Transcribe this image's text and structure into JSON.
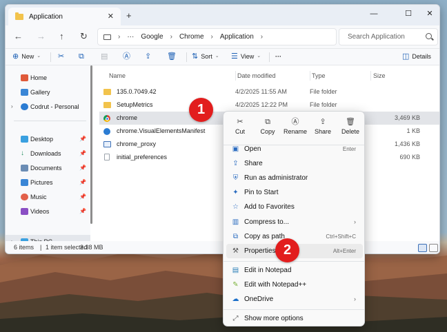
{
  "window": {
    "tab_title": "Application",
    "new_tab": "+",
    "controls": {
      "minimize": "—",
      "maximize": "☐",
      "close": "✕"
    }
  },
  "address": {
    "breadcrumbs": [
      "Google",
      "Chrome",
      "Application"
    ],
    "ellipsis": "···",
    "search_placeholder": "Search Application"
  },
  "commands": {
    "new": "New",
    "sort": "Sort",
    "view": "View",
    "more": "···",
    "details": "Details"
  },
  "sidebar": {
    "items": [
      {
        "label": "Home"
      },
      {
        "label": "Gallery"
      },
      {
        "label": "Codrut - Personal"
      },
      {
        "label": "Desktop"
      },
      {
        "label": "Downloads"
      },
      {
        "label": "Documents"
      },
      {
        "label": "Pictures"
      },
      {
        "label": "Music"
      },
      {
        "label": "Videos"
      },
      {
        "label": "This PC"
      }
    ]
  },
  "columns": {
    "name": "Name",
    "date": "Date modified",
    "type": "Type",
    "size": "Size"
  },
  "files": [
    {
      "name": "135.0.7049.42",
      "date": "4/2/2025 11:55 AM",
      "type": "File folder",
      "size": ""
    },
    {
      "name": "SetupMetrics",
      "date": "4/2/2025 12:22 PM",
      "type": "File folder",
      "size": ""
    },
    {
      "name": "chrome",
      "date": "",
      "type": "",
      "size": "3,469 KB"
    },
    {
      "name": "chrome.VisualElementsManifest",
      "date": "",
      "type": "",
      "size": "1 KB"
    },
    {
      "name": "chrome_proxy",
      "date": "",
      "type": "",
      "size": "1,436 KB"
    },
    {
      "name": "initial_preferences",
      "date": "",
      "type": "",
      "size": "690 KB"
    }
  ],
  "status": {
    "count": "6 items",
    "selected": "1 item selected",
    "size": "3.38 MB"
  },
  "context_menu": {
    "actions": [
      "Cut",
      "Copy",
      "Rename",
      "Share",
      "Delete"
    ],
    "items": [
      {
        "label": "Open",
        "shortcut": "Enter"
      },
      {
        "label": "Share",
        "shortcut": ""
      },
      {
        "label": "Run as administrator",
        "shortcut": ""
      },
      {
        "label": "Pin to Start",
        "shortcut": ""
      },
      {
        "label": "Add to Favorites",
        "shortcut": ""
      },
      {
        "label": "Compress to...",
        "shortcut": ""
      },
      {
        "label": "Copy as path",
        "shortcut": "Ctrl+Shift+C"
      },
      {
        "label": "Properties",
        "shortcut": "Alt+Enter"
      },
      {
        "label": "Edit in Notepad",
        "shortcut": ""
      },
      {
        "label": "Edit with Notepad++",
        "shortcut": ""
      },
      {
        "label": "OneDrive",
        "shortcut": ""
      },
      {
        "label": "Show more options",
        "shortcut": ""
      }
    ]
  },
  "callouts": [
    "1",
    "2"
  ],
  "colors": {
    "accent": "#1b5fb4",
    "callout": "#e21d1d",
    "folder": "#f2c34c"
  }
}
